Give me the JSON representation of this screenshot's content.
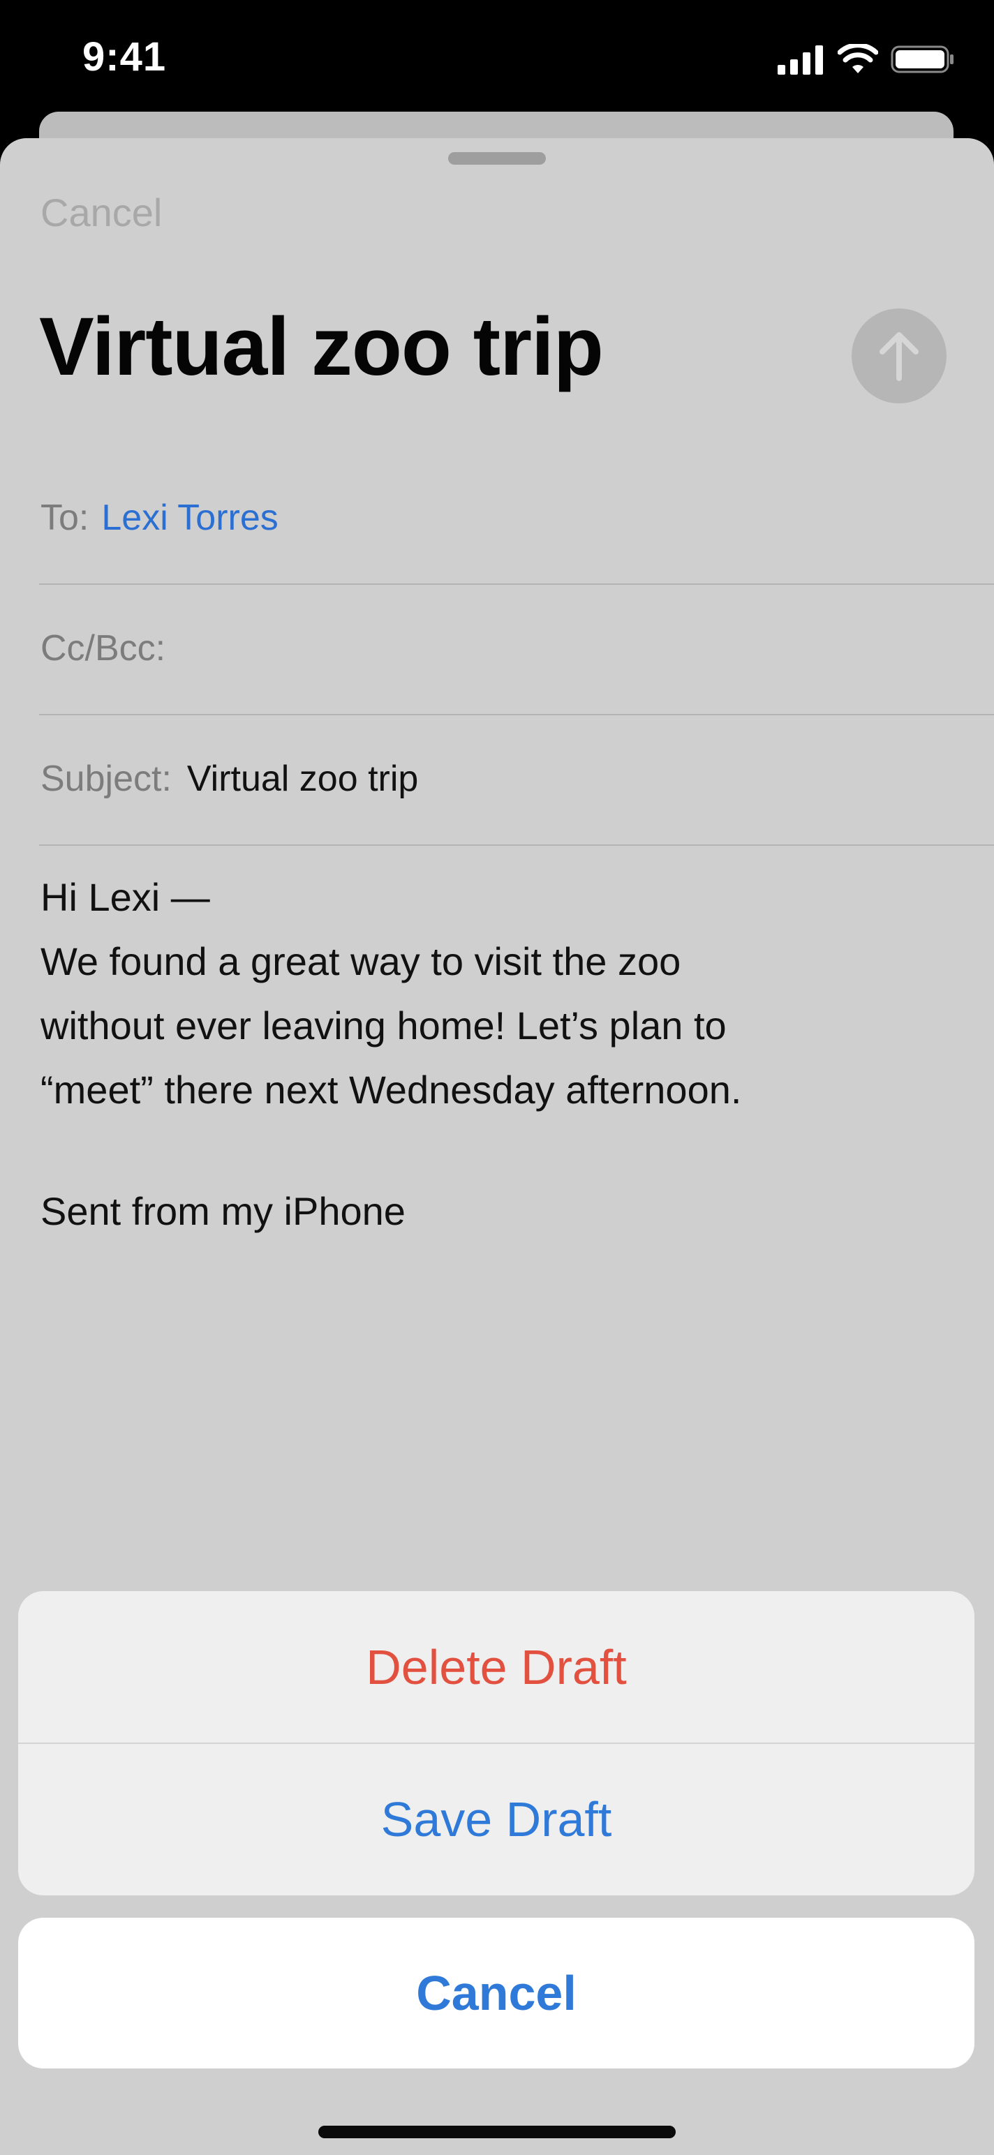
{
  "status_bar": {
    "time": "9:41",
    "icons": [
      "cellular-signal-icon",
      "wifi-icon",
      "battery-icon"
    ]
  },
  "compose": {
    "cancel_label": "Cancel",
    "title": "Virtual zoo trip",
    "send_icon": "arrow-up-icon",
    "to_label": "To:",
    "to_value": "Lexi Torres",
    "cc_label": "Cc/Bcc:",
    "subject_label": "Subject:",
    "subject_value": "Virtual zoo trip",
    "body_lines": [
      "Hi Lexi —",
      "We found a great way to visit the zoo",
      "without ever leaving home! Let’s plan to",
      "“meet” there next Wednesday afternoon."
    ],
    "signature": "Sent from my iPhone"
  },
  "action_sheet": {
    "delete_label": "Delete Draft",
    "save_label": "Save Draft",
    "cancel_label": "Cancel"
  },
  "colors": {
    "destructive": "#e2513f",
    "accent": "#2f7ad8",
    "link": "#2b6fd3"
  }
}
